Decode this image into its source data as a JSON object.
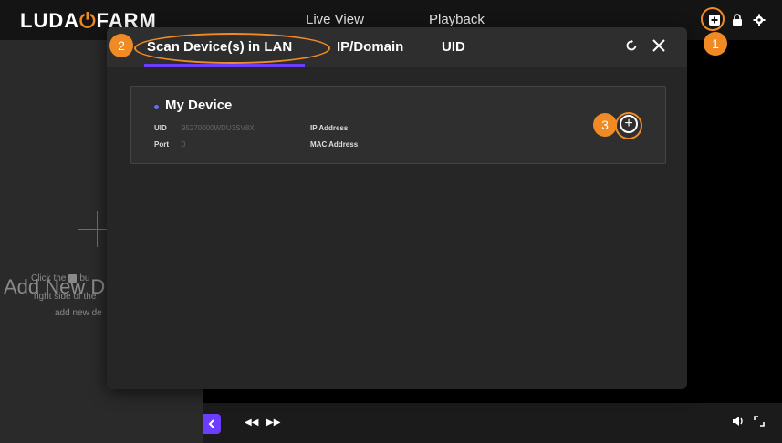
{
  "app": {
    "logo_left": "LUDA",
    "logo_right": "FARM",
    "nav": [
      "Live View",
      "Playback"
    ]
  },
  "sidebar": {
    "add_new_title": "Add New D",
    "hint_line1_a": "Click the",
    "hint_line1_b": "bu",
    "hint_line2": "right side of the",
    "hint_line3": "add new de"
  },
  "modal": {
    "tabs": [
      "Scan Device(s) in LAN",
      "IP/Domain",
      "UID"
    ],
    "active_tab": 0,
    "refresh_icon": "refresh-icon",
    "close_icon": "close-icon"
  },
  "device": {
    "name": "My Device",
    "uid_label": "UID",
    "uid_value": "95270000WDU3SV8X",
    "port_label": "Port",
    "port_value": "0",
    "ip_label": "IP Address",
    "mac_label": "MAC Address"
  },
  "callouts": [
    "1",
    "2",
    "3"
  ],
  "colors": {
    "accent": "#6a3dff",
    "callout": "#f08a24"
  }
}
